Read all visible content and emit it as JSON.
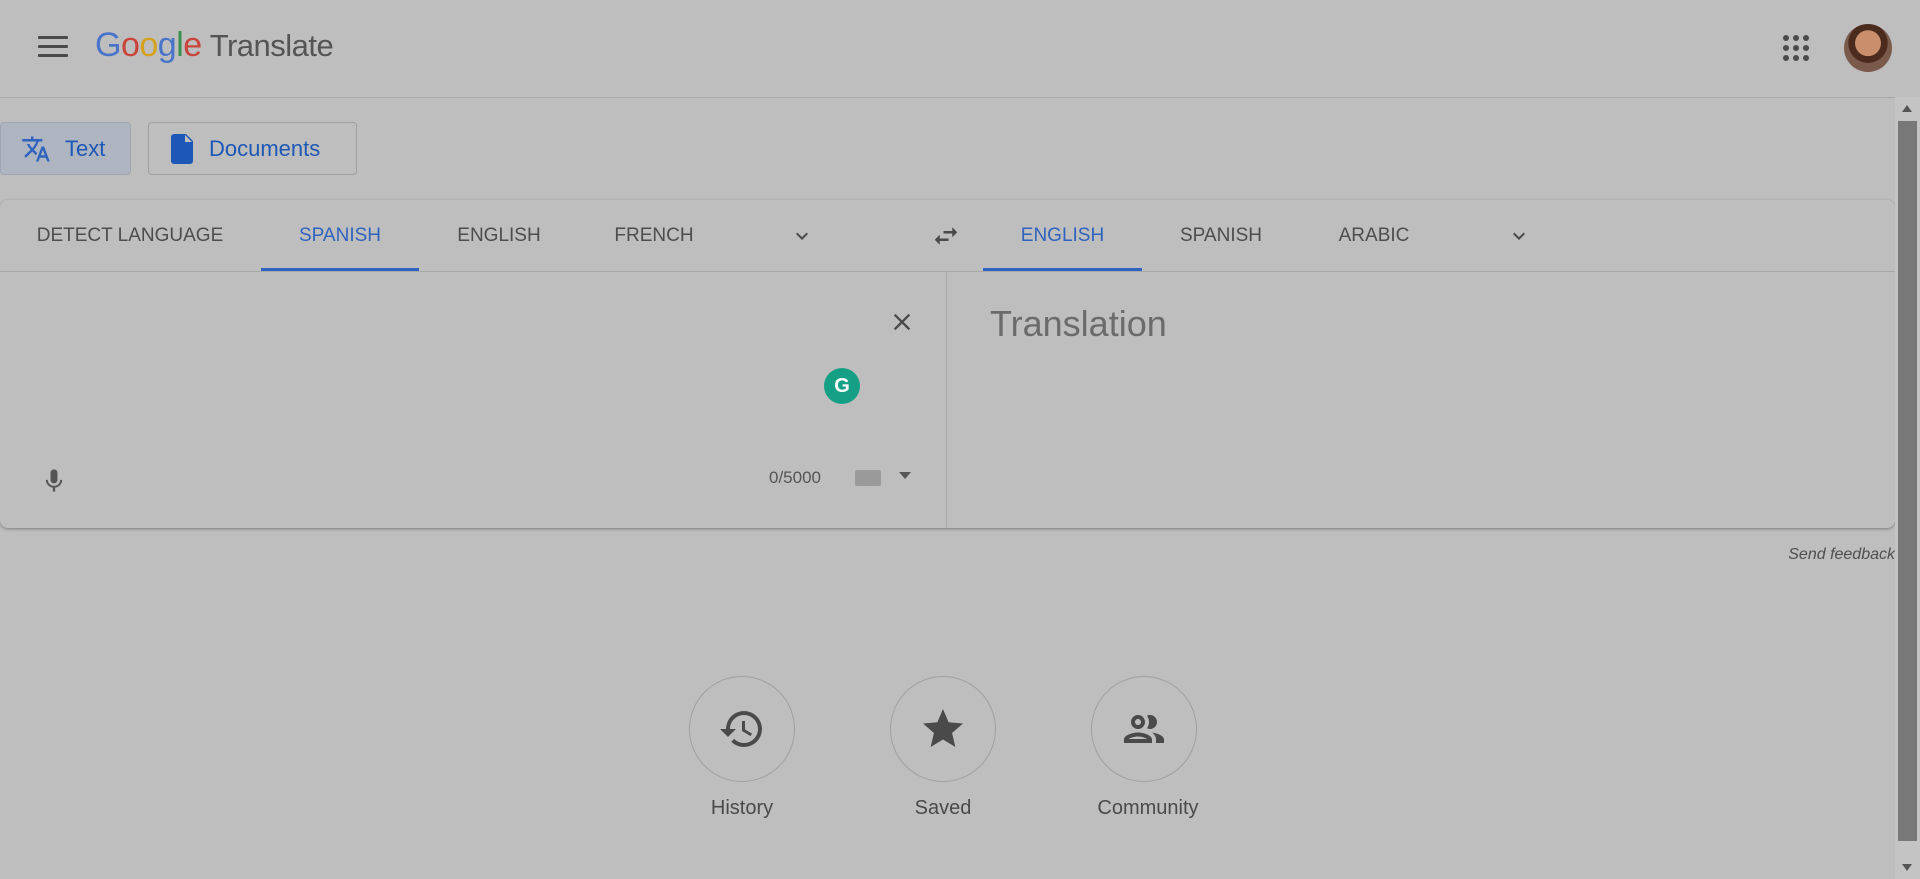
{
  "header": {
    "logo_parts": [
      "G",
      "o",
      "o",
      "g",
      "l",
      "e"
    ],
    "product": "Translate",
    "menu_icon": "hamburger-menu-icon",
    "apps_icon": "apps-grid-icon"
  },
  "modes": {
    "text_label": "Text",
    "documents_label": "Documents"
  },
  "source_langs": [
    "DETECT LANGUAGE",
    "SPANISH",
    "ENGLISH",
    "FRENCH"
  ],
  "source_active": "SPANISH",
  "target_langs": [
    "ENGLISH",
    "SPANISH",
    "ARABIC"
  ],
  "target_active": "ENGLISH",
  "input": {
    "char_count": "0/5000",
    "grammarly_letter": "G"
  },
  "output": {
    "placeholder": "Translation"
  },
  "feedback_label": "Send feedback",
  "bottom_buttons": {
    "history": "History",
    "saved": "Saved",
    "community": "Community"
  },
  "colors": {
    "accent": "#2f63bf",
    "background": "#bebebe",
    "grammarly": "#15a085"
  }
}
